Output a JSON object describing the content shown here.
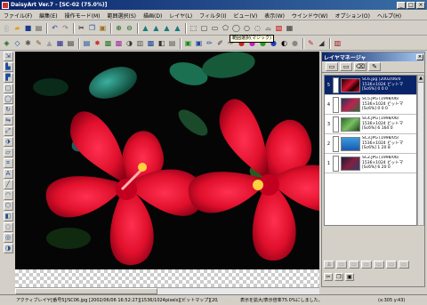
{
  "window": {
    "title": "DaisyArt Ver.7 - [SC-02 (75.0%)]",
    "controls": [
      "_",
      "□",
      "×"
    ]
  },
  "menu": [
    "ファイル(F)",
    "編集(E)",
    "操作モード(M)",
    "範囲選択(S)",
    "描画(D)",
    "レイヤ(L)",
    "フィルタ(I)",
    "ビュー(V)",
    "表示(W)",
    "ウインドウ(W)",
    "オプション(O)",
    "ヘルプ(H)"
  ],
  "toolbar": {
    "tooltip": "範囲選択(マジック)"
  },
  "layer_manager": {
    "title": "レイヤマネージャ",
    "close": "×",
    "rows": [
      {
        "num": "5",
        "line1": "SC6.jpg [2002/06/0",
        "line2": "1536×1024 ビットマ",
        "line3": "[Sc6%] 0 0 0"
      },
      {
        "num": "4",
        "line1": "SC5.JPG [1998/06/",
        "line2": "1536×1024 ビットマ",
        "line3": "[Sc6%] 0 0 0"
      },
      {
        "num": "3",
        "line1": "SC4.JPG [1998/06/",
        "line2": "1536×1024 ビットマ",
        "line3": "[Sc6%] 6 164 0"
      },
      {
        "num": "2",
        "line1": "SC3.JPG [1998/05/",
        "line2": "1536×1024 ビットマ",
        "line3": "[Sc6%] 1 20 8"
      },
      {
        "num": "1",
        "line1": "SC2.JPG [1998/06/",
        "line2": "1536×1024 ビットマ",
        "line3": "[Sc6%] 6 20 0"
      }
    ]
  },
  "status": {
    "left": "アクティブレイヤ[番号5]/SC06.jpg [2002/06/06 16:52:27][1536/1024pixels][ビットマップ][20/8/0 0 0]",
    "middle": "表示を拡大/表示倍率75.0%にしました。",
    "right": "(x:305 y:43)"
  }
}
